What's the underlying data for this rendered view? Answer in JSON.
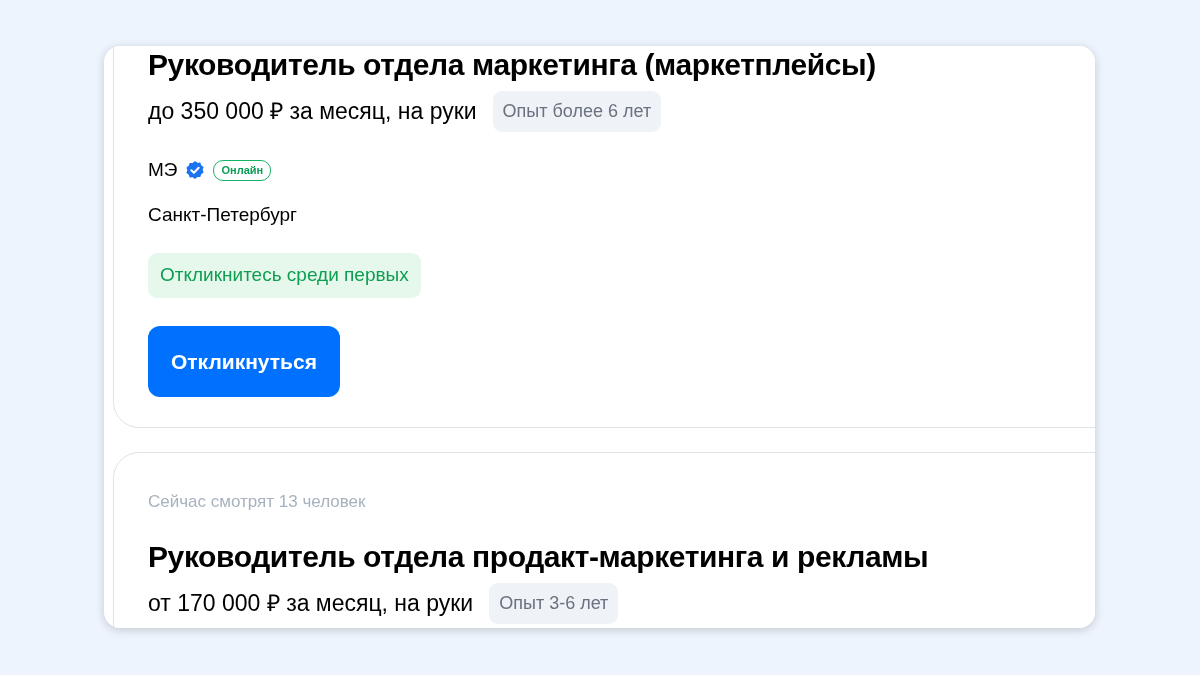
{
  "vacancies": [
    {
      "title": "Руководитель отдела маркетинга (маркетплейсы)",
      "salary": "до 350 000 ₽ за месяц, на руки",
      "experience": "Опыт более 6 лет",
      "company": {
        "name": "МЭ",
        "verified": true,
        "status": "Онлайн"
      },
      "city": "Санкт-Петербург",
      "highlight": "Откликнитесь среди первых",
      "button": "Откликнуться"
    },
    {
      "viewers": "Сейчас смотрят 13 человек",
      "title": "Руководитель отдела продакт-маркетинга и рекламы",
      "salary": "от 170 000 ₽ за месяц, на руки",
      "experience": "Опыт 3-6 лет"
    }
  ]
}
